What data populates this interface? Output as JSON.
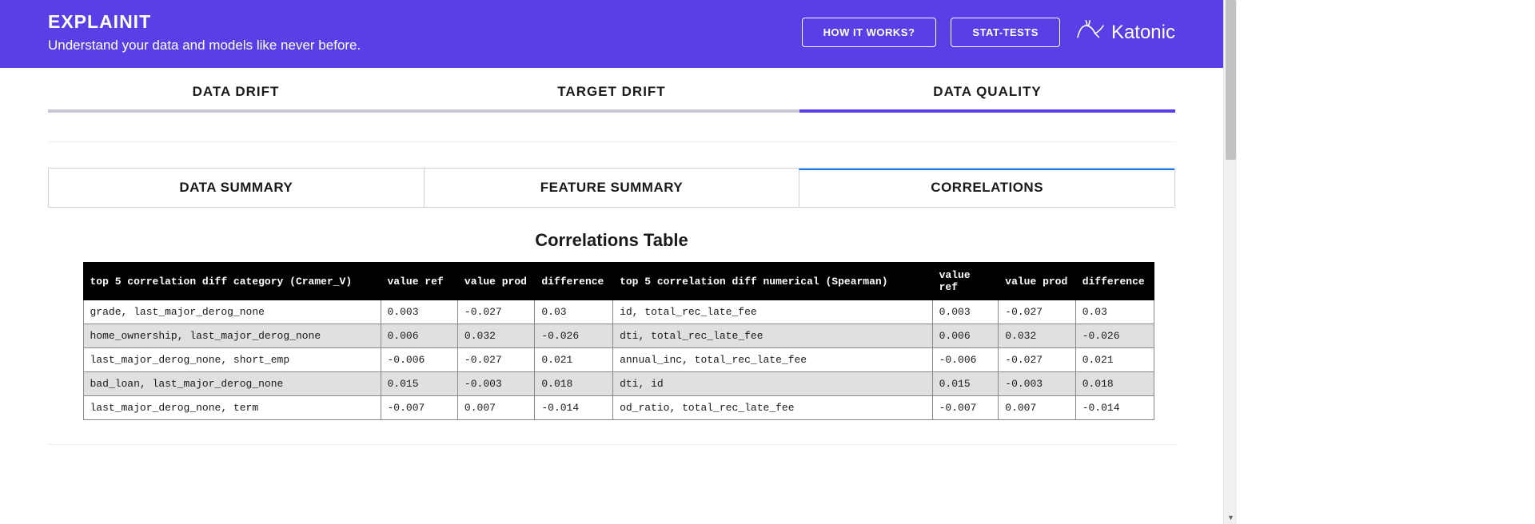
{
  "header": {
    "title": "EXPLAINIT",
    "subtitle": "Understand your data and models like never before.",
    "how_button": "HOW IT WORKS?",
    "stat_button": "STAT-TESTS",
    "brand": "Katonic"
  },
  "primary_tabs": {
    "items": [
      "DATA DRIFT",
      "TARGET DRIFT",
      "DATA QUALITY"
    ],
    "active_index": 2
  },
  "secondary_tabs": {
    "items": [
      "DATA SUMMARY",
      "FEATURE SUMMARY",
      "CORRELATIONS"
    ],
    "active_index": 2
  },
  "table": {
    "title": "Correlations Table",
    "headers": [
      "top 5 correlation diff category (Cramer_V)",
      "value ref",
      "value prod",
      "difference",
      "top 5 correlation diff numerical (Spearman)",
      "value ref",
      "value prod",
      "difference"
    ],
    "rows": [
      [
        "grade, last_major_derog_none",
        "0.003",
        "-0.027",
        "0.03",
        "id, total_rec_late_fee",
        "0.003",
        "-0.027",
        "0.03"
      ],
      [
        "home_ownership, last_major_derog_none",
        "0.006",
        "0.032",
        "-0.026",
        "dti, total_rec_late_fee",
        "0.006",
        "0.032",
        "-0.026"
      ],
      [
        "last_major_derog_none, short_emp",
        "-0.006",
        "-0.027",
        "0.021",
        "annual_inc, total_rec_late_fee",
        "-0.006",
        "-0.027",
        "0.021"
      ],
      [
        "bad_loan, last_major_derog_none",
        "0.015",
        "-0.003",
        "0.018",
        "dti, id",
        "0.015",
        "-0.003",
        "0.018"
      ],
      [
        "last_major_derog_none, term",
        "-0.007",
        "0.007",
        "-0.014",
        "od_ratio, total_rec_late_fee",
        "-0.007",
        "0.007",
        "-0.014"
      ]
    ]
  }
}
